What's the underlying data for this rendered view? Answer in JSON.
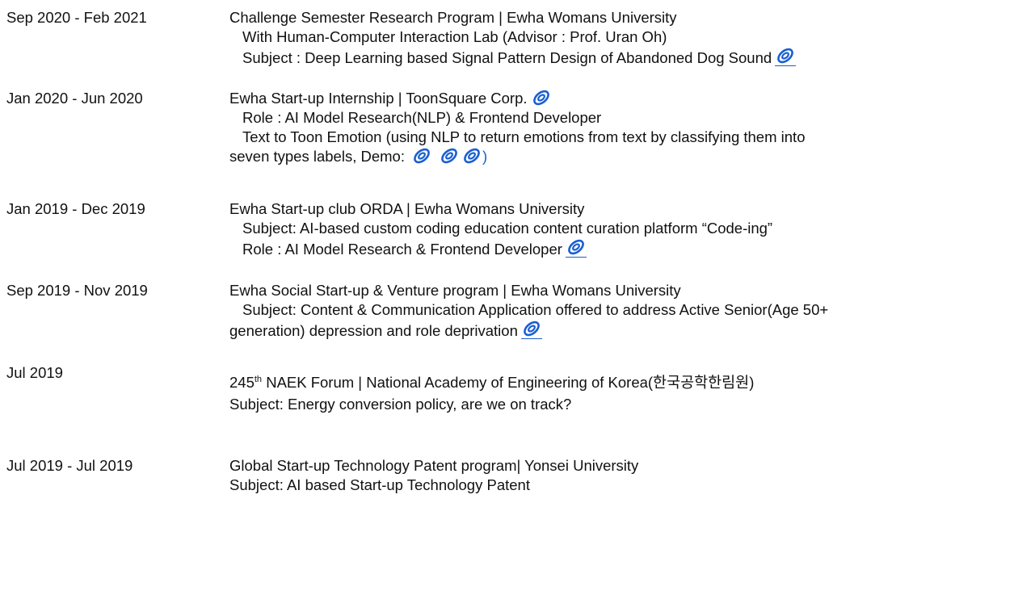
{
  "entries": [
    {
      "date": "Sep 2020 -  Feb 2021",
      "title": "Challenge Semester Research Program | Ewha Womans University",
      "line2": "With Human-Computer Interaction Lab (Advisor : Prof. Uran Oh)",
      "line3": "Subject : Deep Learning based Signal Pattern Design of Abandoned Dog Sound"
    },
    {
      "date": "Jan 2020 - Jun 2020",
      "title": "Ewha Start-up Internship  | ToonSquare Corp.",
      "line2": "Role : AI Model Research(NLP) & Frontend Developer",
      "line3": "Text to Toon Emotion (using NLP to return emotions from text by classifying them into",
      "line4": "seven types labels, Demo:",
      "close_paren": ")"
    },
    {
      "date": "Jan 2019 - Dec 2019",
      "title": "Ewha Start-up club ORDA | Ewha Womans University",
      "line2": "Subject: AI-based custom coding education content curation platform “Code-ing”",
      "line3": "Role : AI Model Research  & Frontend Developer"
    },
    {
      "date": "Sep 2019 - Nov 2019",
      "title": "Ewha Social Start-up & Venture program | Ewha Womans University",
      "line2": "Subject: Content & Communication Application offered to address Active Senior(Age 50+",
      "line3": "generation) depression and role deprivation"
    },
    {
      "date": "Jul 2019",
      "title_num": "245",
      "title_sup": "th",
      "title_rest": " NAEK Forum | National Academy of Engineering of Korea(한국공학한림원)",
      "line2": "Subject: Energy conversion policy, are we on track?"
    },
    {
      "date": "Jul 2019 - Jul 2019",
      "title": "Global Start-up Technology Patent program| Yonsei University",
      "line2": "Subject: AI based Start-up Technology Patent"
    }
  ],
  "colors": {
    "link": "#1a5fd1",
    "text": "#111111"
  },
  "icons": {
    "link": "paperclip-link-icon"
  }
}
